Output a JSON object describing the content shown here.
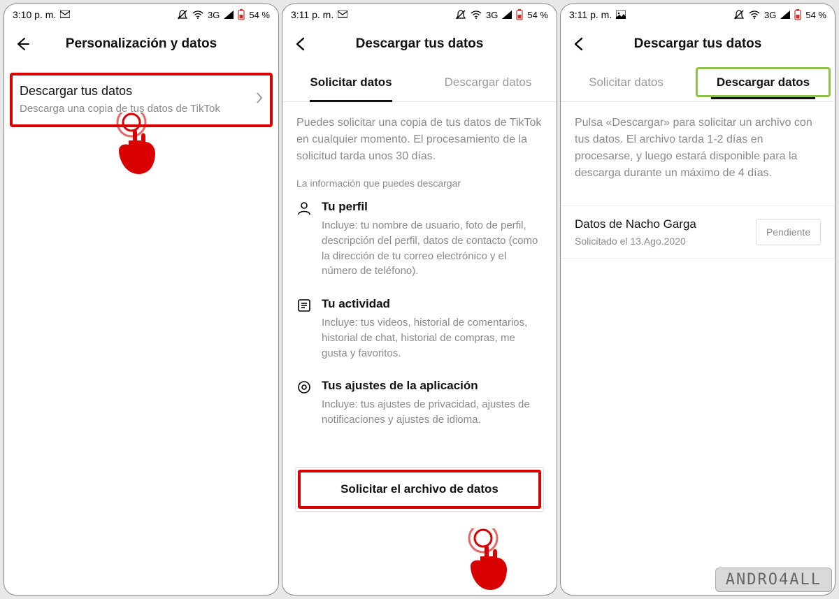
{
  "watermark": "ANDRO4ALL",
  "screens": [
    {
      "status": {
        "time": "3:10 p. m.",
        "net": "3G",
        "battery": "54 %"
      },
      "title": "Personalización y datos",
      "row": {
        "title": "Descargar tus datos",
        "subtitle": "Descarga una copia de tus datos de TikTok"
      }
    },
    {
      "status": {
        "time": "3:11 p. m.",
        "net": "3G",
        "battery": "54 %"
      },
      "title": "Descargar tus datos",
      "tabs": {
        "a": "Solicitar datos",
        "b": "Descargar datos"
      },
      "intro": "Puedes solicitar una copia de tus datos de TikTok en cualquier momento. El procesamiento de la solicitud tarda unos 30 días.",
      "sectionhdr": "La información que puedes descargar",
      "items": [
        {
          "title": "Tu perfil",
          "desc": "Incluye: tu nombre de usuario, foto de perfil, descripción del perfil, datos de contacto (como la dirección de tu correo electrónico y el número de teléfono)."
        },
        {
          "title": "Tu actividad",
          "desc": "Incluye: tus videos, historial de comentarios, historial de chat, historial de compras, me gusta y favoritos."
        },
        {
          "title": "Tus ajustes de la aplicación",
          "desc": "Incluye: tus ajustes de privacidad, ajustes de notificaciones y ajustes de idioma."
        }
      ],
      "button": "Solicitar el archivo de datos"
    },
    {
      "status": {
        "time": "3:11 p. m.",
        "net": "3G",
        "battery": "54 %"
      },
      "title": "Descargar tus datos",
      "tabs": {
        "a": "Solicitar datos",
        "b": "Descargar datos"
      },
      "intro": "Pulsa «Descargar» para solicitar un archivo con tus datos. El archivo tarda 1-2 días en procesarse, y luego estará disponible para la descarga durante un máximo de 4 días.",
      "pending": {
        "title": "Datos de Nacho Garga",
        "date": "Solicitado el 13.Ago.2020",
        "status": "Pendiente"
      }
    }
  ]
}
